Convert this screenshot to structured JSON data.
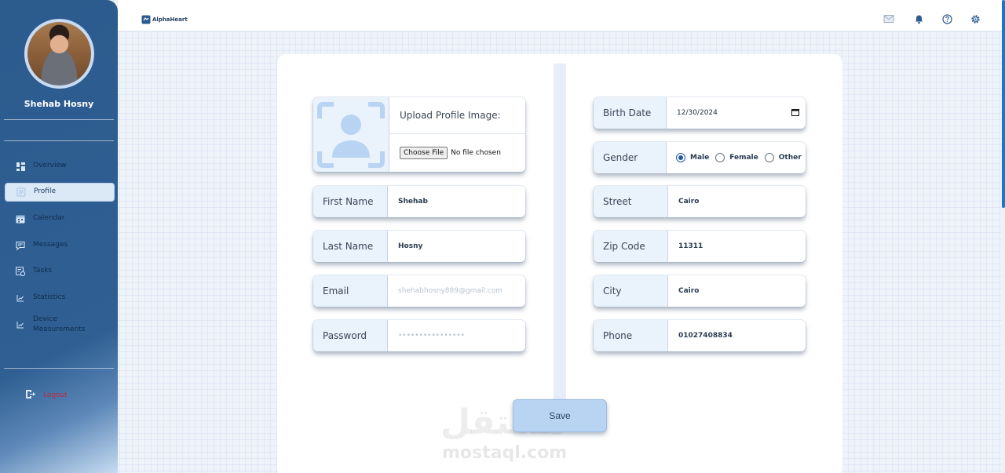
{
  "header": {
    "logo_text": "AlphaHeart",
    "icons": [
      "mail-icon",
      "bell-icon",
      "help-icon",
      "settings-icon"
    ]
  },
  "sidebar": {
    "user_name": "Shehab Hosny",
    "items": [
      {
        "label": "Overview",
        "icon": "overview-icon"
      },
      {
        "label": "Profile",
        "icon": "profile-icon",
        "active": true
      },
      {
        "label": "Calendar",
        "icon": "calendar-icon"
      },
      {
        "label": "Messages",
        "icon": "messages-icon"
      },
      {
        "label": "Tasks",
        "icon": "tasks-icon"
      },
      {
        "label": "Statistics",
        "icon": "statistics-icon"
      },
      {
        "label": "Device Measurements",
        "icon": "device-measurements-icon"
      }
    ],
    "logout_label": "Logout"
  },
  "form": {
    "upload": {
      "title": "Upload Profile Image:",
      "choose_label": "Choose File",
      "status": "No file chosen"
    },
    "left": {
      "first_name": {
        "label": "First Name",
        "value": "Shehab"
      },
      "last_name": {
        "label": "Last Name",
        "value": "Hosny"
      },
      "email": {
        "label": "Email",
        "placeholder": "shehabhosny889@gmail.com"
      },
      "password": {
        "label": "Password",
        "placeholder": "••••••••••••••••"
      }
    },
    "right": {
      "birth_date": {
        "label": "Birth Date",
        "value": "12/30/2024"
      },
      "gender": {
        "label": "Gender",
        "options": [
          "Male",
          "Female",
          "Other"
        ],
        "selected": "Male"
      },
      "street": {
        "label": "Street",
        "value": "Cairo"
      },
      "zip_code": {
        "label": "Zip Code",
        "value": "11311"
      },
      "city": {
        "label": "City",
        "value": "Cairo"
      },
      "phone": {
        "label": "Phone",
        "value": "01027408834"
      }
    },
    "save_label": "Save"
  },
  "watermark": {
    "arabic": "مستقل",
    "latin": "mostaql.com"
  },
  "colors": {
    "sidebar": "#2c5b8e",
    "accent": "#1e5aa8",
    "field_label_bg": "#eaf2fb",
    "logout": "#c0283a"
  }
}
